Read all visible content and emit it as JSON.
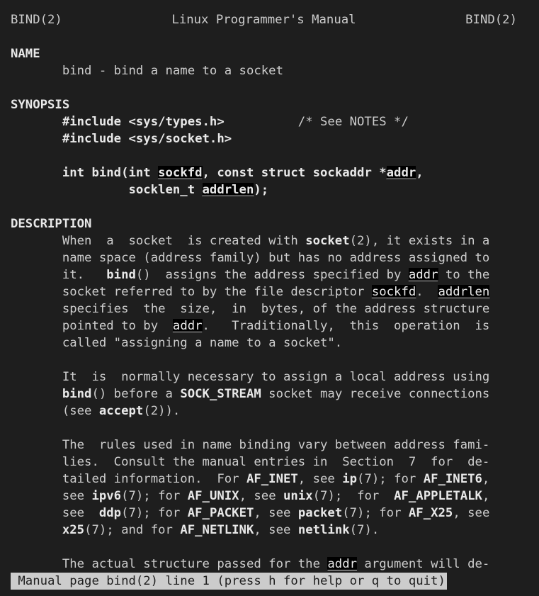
{
  "header": {
    "left": "BIND(2)",
    "center": "Linux Programmer's Manual",
    "right": "BIND(2)"
  },
  "name": {
    "heading": "NAME",
    "text": "bind - bind a name to a socket"
  },
  "synopsis": {
    "heading": "SYNOPSIS",
    "include1": "#include <sys/types.h>",
    "include1_comment": "/* See NOTES */",
    "include2": "#include <sys/socket.h>",
    "proto_a": "int bind(int ",
    "proto_sockfd": "sockfd",
    "proto_b": ", const struct sockaddr *",
    "proto_addr": "addr",
    "proto_c": ",",
    "proto_d": "socklen_t ",
    "proto_addrlen": "addrlen",
    "proto_e": ");"
  },
  "description": {
    "heading": "DESCRIPTION",
    "p1": {
      "l1a": "When  a  socket  is created with ",
      "l1b": "socket",
      "l1c": "(2), it exists in a",
      "l2": "name space (address family) but has no address assigned to",
      "l3a": "it.   ",
      "l3b": "bind",
      "l3c": "()  assigns the address specified by ",
      "l3d": "addr",
      "l3e": " to the",
      "l4a": "socket referred to by the file descriptor ",
      "l4b": "sockfd",
      "l4c": ".  ",
      "l4d": "addrlen",
      "l5": "specifies  the  size,  in  bytes, of the address structure",
      "l6a": "pointed to by  ",
      "l6b": "addr",
      "l6c": ".   Traditionally,  this  operation  is",
      "l7": "called \"assigning a name to a socket\"."
    },
    "p2": {
      "l1": "It  is  normally necessary to assign a local address using",
      "l2a": "bind",
      "l2b": "() before a ",
      "l2c": "SOCK_STREAM",
      "l2d": " socket may receive connections",
      "l3a": "(see ",
      "l3b": "accept",
      "l3c": "(2))."
    },
    "p3": {
      "l1": "The  rules used in name binding vary between address fami-",
      "l2": "lies.  Consult the manual entries in  Section  7  for  de-",
      "l3a": "tailed information.  For ",
      "l3b": "AF_INET",
      "l3c": ", see ",
      "l3d": "ip",
      "l3e": "(7); for ",
      "l3f": "AF_INET6",
      "l3g": ",",
      "l4a": "see ",
      "l4b": "ipv6",
      "l4c": "(7); for ",
      "l4d": "AF_UNIX",
      "l4e": ", see ",
      "l4f": "unix",
      "l4g": "(7);  for  ",
      "l4h": "AF_APPLETALK",
      "l4i": ",",
      "l5a": "see  ",
      "l5b": "ddp",
      "l5c": "(7); for ",
      "l5d": "AF_PACKET",
      "l5e": ", see ",
      "l5f": "packet",
      "l5g": "(7); for ",
      "l5h": "AF_X25",
      "l5i": ", see",
      "l6a": "x25",
      "l6b": "(7); and for ",
      "l6c": "AF_NETLINK",
      "l6d": ", see ",
      "l6e": "netlink",
      "l6f": "(7)."
    },
    "p4": {
      "l1a": "The actual structure passed for the ",
      "l1b": "addr",
      "l1c": " argument will de-"
    }
  },
  "status_bar": {
    "text": " Manual page bind(2) line 1 (press h for help or q to quit)"
  },
  "colors": {
    "background": "#1e1e1e",
    "foreground": "#cccccc",
    "highlight_bg": "#000000",
    "status_bg": "#cccccc"
  }
}
